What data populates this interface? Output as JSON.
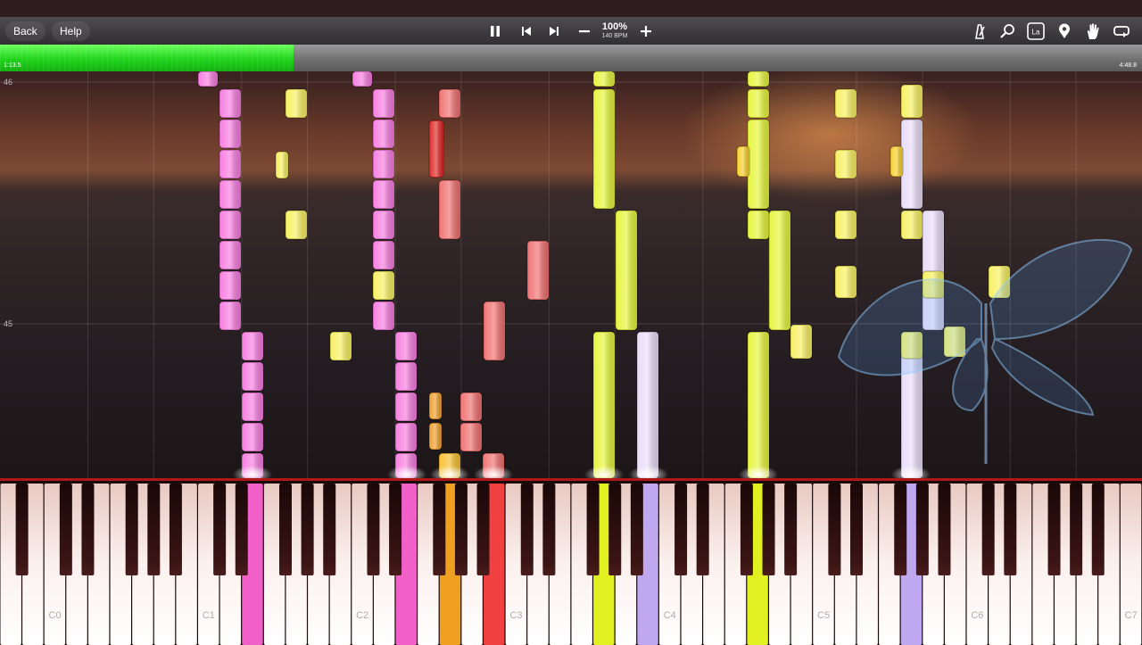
{
  "toolbar": {
    "back_label": "Back",
    "help_label": "Help",
    "zoom_percent": "100%",
    "tempo": "140 BPM",
    "icons": [
      "pause-icon",
      "previous-icon",
      "next-icon",
      "minus-icon",
      "plus-icon",
      "metronome-icon",
      "search-icon",
      "label-icon",
      "location-pin-icon",
      "hand-icon",
      "loop-icon"
    ],
    "label_icon_text": "La"
  },
  "progress": {
    "elapsed": "1:13.5",
    "total": "4:48.8",
    "fraction": 0.257
  },
  "measures": [
    "46",
    "45"
  ],
  "keyboard": {
    "octave_labels": [
      "C0",
      "C1",
      "C2",
      "C3",
      "C4",
      "C5",
      "C6",
      "C7"
    ],
    "lit_keys": [
      {
        "white_index": 11,
        "color": "#f060c8"
      },
      {
        "white_index": 18,
        "color": "#f060c8"
      },
      {
        "white_index": 20,
        "color": "#f0a020"
      },
      {
        "white_index": 22,
        "color": "#f04040"
      },
      {
        "white_index": 27,
        "color": "#e0f020"
      },
      {
        "white_index": 29,
        "color": "#c0a8f0"
      },
      {
        "white_index": 34,
        "color": "#e0f020"
      },
      {
        "white_index": 41,
        "color": "#c0a8f0"
      }
    ]
  },
  "colors": {
    "pink": "#f77ce0",
    "yellow": "#f7f060",
    "red": "#f07070",
    "orange": "#f0a030",
    "lime": "#e6f53a",
    "lavender": "#e8dcf7",
    "progress_green": "#22dd1c"
  }
}
